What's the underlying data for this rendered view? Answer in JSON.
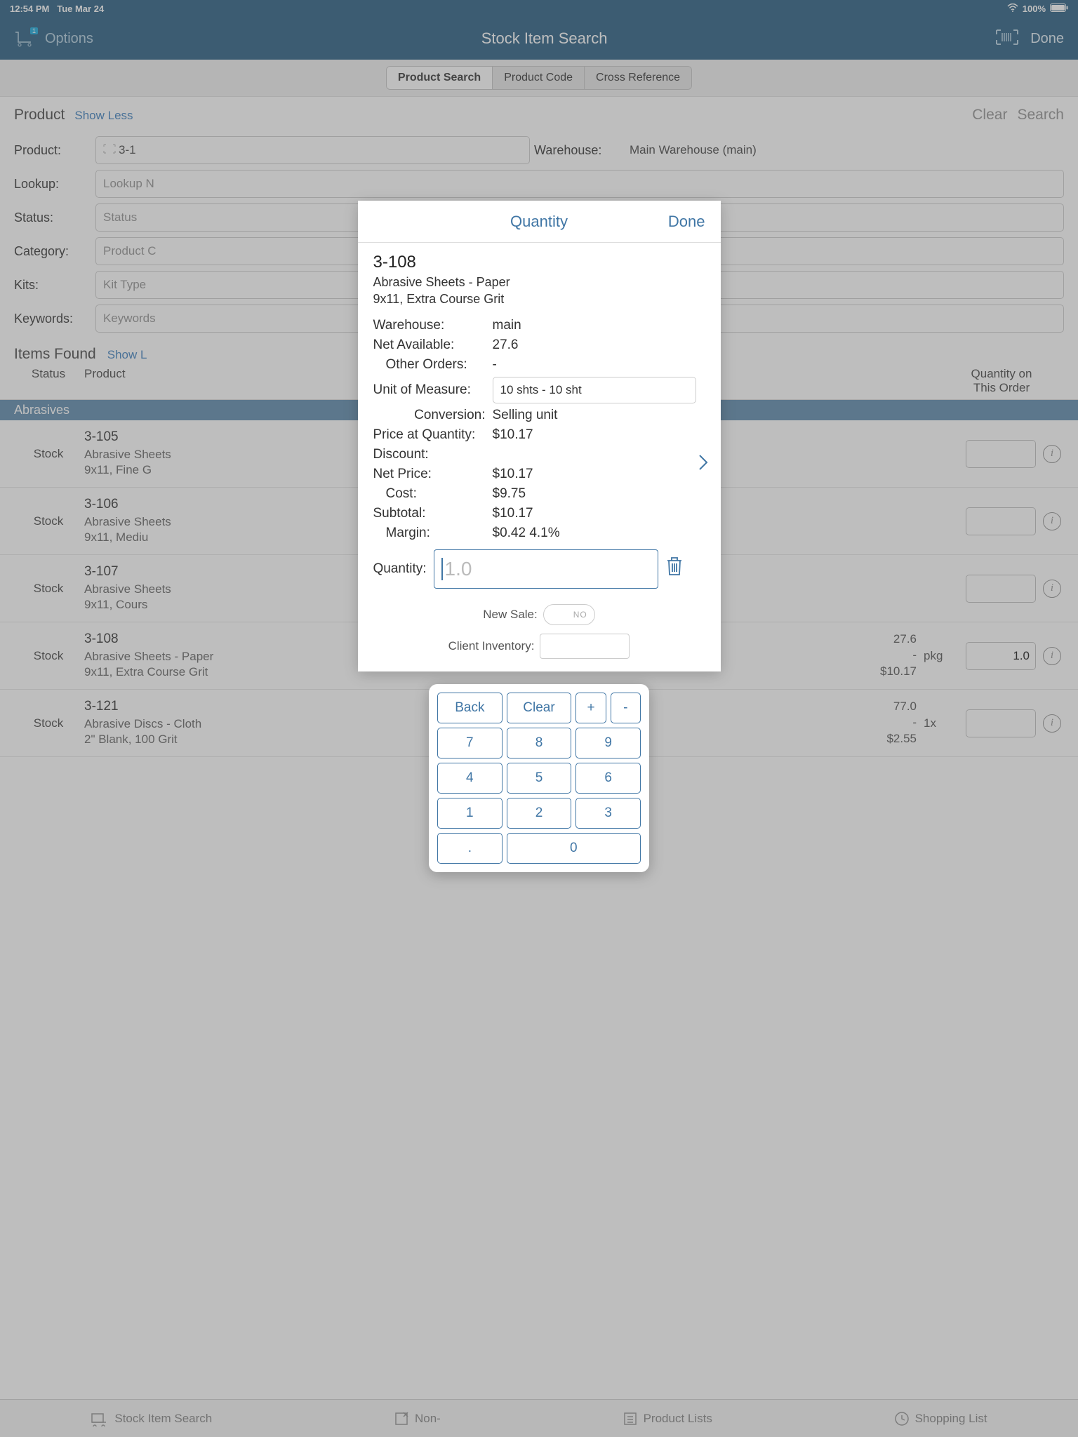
{
  "status_bar": {
    "time": "12:54 PM",
    "date": "Tue Mar 24",
    "battery": "100%"
  },
  "header": {
    "options": "Options",
    "title": "Stock Item Search",
    "done": "Done",
    "cart_count": "1"
  },
  "segments": {
    "product_search": "Product Search",
    "product_code": "Product Code",
    "cross_reference": "Cross Reference"
  },
  "search": {
    "section_title": "Product",
    "show_less": "Show Less",
    "clear": "Clear",
    "search": "Search",
    "labels": {
      "product": "Product:",
      "warehouse": "Warehouse:",
      "lookup": "Lookup:",
      "status": "Status:",
      "category": "Category:",
      "kits": "Kits:",
      "keywords": "Keywords:"
    },
    "values": {
      "product": "3-1",
      "warehouse": "Main Warehouse (main)"
    },
    "placeholders": {
      "lookup": "Lookup N",
      "status": "Status",
      "category": "Product C",
      "kits": "Kit Type",
      "keywords": "Keywords"
    }
  },
  "items": {
    "section_title": "Items Found",
    "show_link": "Show L",
    "columns": {
      "status": "Status",
      "product": "Product",
      "qty": "Quantity on\nThis Order"
    },
    "group": "Abrasives",
    "rows": [
      {
        "status": "Stock",
        "code": "3-105",
        "desc": "Abrasive Sheets\n9x11, Fine G",
        "n1": "",
        "n2": "",
        "n3": "",
        "uom": "",
        "qty": ""
      },
      {
        "status": "Stock",
        "code": "3-106",
        "desc": "Abrasive Sheets\n9x11, Mediu",
        "n1": "",
        "n2": "",
        "n3": "",
        "uom": "",
        "qty": ""
      },
      {
        "status": "Stock",
        "code": "3-107",
        "desc": "Abrasive Sheets\n9x11, Cours",
        "n1": "",
        "n2": "",
        "n3": "",
        "uom": "",
        "qty": ""
      },
      {
        "status": "Stock",
        "code": "3-108",
        "desc": "Abrasive Sheets - Paper\n9x11, Extra Course Grit",
        "n1": "27.6",
        "n2": "-",
        "n3": "$10.17",
        "uom": "pkg",
        "qty": "1.0"
      },
      {
        "status": "Stock",
        "code": "3-121",
        "desc": "Abrasive Discs - Cloth\n2\" Blank, 100 Grit",
        "n1": "77.0",
        "n2": "-",
        "n3": "$2.55",
        "uom": "1x",
        "qty": ""
      }
    ]
  },
  "bottom": {
    "stock": "Stock Item Search",
    "non": "Non-",
    "lists": "Product Lists",
    "shopping": "Shopping List"
  },
  "modal": {
    "title": "Quantity",
    "done": "Done",
    "code": "3-108",
    "desc": "Abrasive Sheets - Paper\n9x11, Extra Course Grit",
    "labels": {
      "warehouse": "Warehouse:",
      "net_available": "Net Available:",
      "other_orders": "Other Orders:",
      "uom": "Unit of Measure:",
      "conversion": "Conversion:",
      "price_at_qty": "Price at Quantity:",
      "discount": "Discount:",
      "net_price": "Net Price:",
      "cost": "Cost:",
      "subtotal": "Subtotal:",
      "margin": "Margin:",
      "quantity": "Quantity:",
      "new_sale": "New Sale:",
      "client_inv": "Client Inventory:"
    },
    "values": {
      "warehouse": "main",
      "net_available": "27.6",
      "other_orders": "-",
      "uom": "10 shts - 10 sht",
      "conversion": "Selling unit",
      "price_at_qty": "$10.17",
      "discount": "",
      "net_price": "$10.17",
      "cost": "$9.75",
      "subtotal": "$10.17",
      "margin": "$0.42  4.1%",
      "quantity": "1.0",
      "new_sale": "NO"
    }
  },
  "keypad": {
    "back": "Back",
    "clear": "Clear",
    "plus": "+",
    "minus": "-",
    "k7": "7",
    "k8": "8",
    "k9": "9",
    "k4": "4",
    "k5": "5",
    "k6": "6",
    "k1": "1",
    "k2": "2",
    "k3": "3",
    "dot": ".",
    "k0": "0"
  }
}
